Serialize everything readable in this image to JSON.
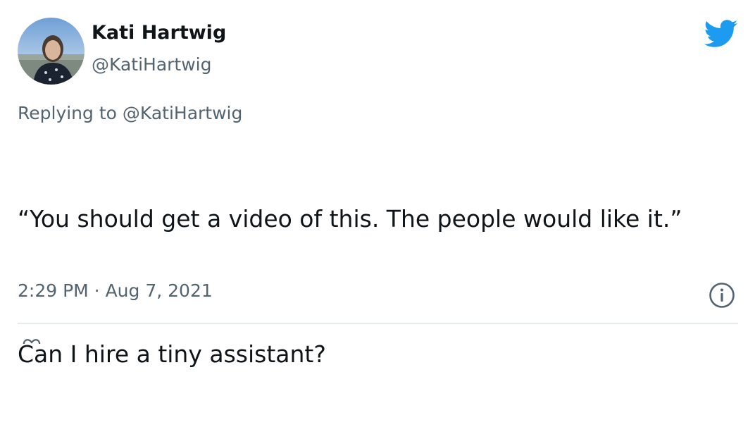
{
  "author": {
    "display_name": "Kati Hartwig",
    "handle": "@KatiHartwig"
  },
  "reply": {
    "prefix": "Replying to ",
    "mention": "@KatiHartwig"
  },
  "tweet": {
    "paragraph_1": "“You should get a video of this. The people would like it.”",
    "paragraph_2": "Can I hire a tiny assistant?"
  },
  "meta": {
    "time": "2:29 PM",
    "separator": " · ",
    "date": "Aug 7, 2021"
  },
  "colors": {
    "brand": "#1d9bf0",
    "secondary_text": "#536471",
    "primary_text": "#0f1419",
    "divider": "#e6ebef"
  },
  "icons": {
    "logo": "twitter-bird-icon",
    "info": "info-icon"
  }
}
